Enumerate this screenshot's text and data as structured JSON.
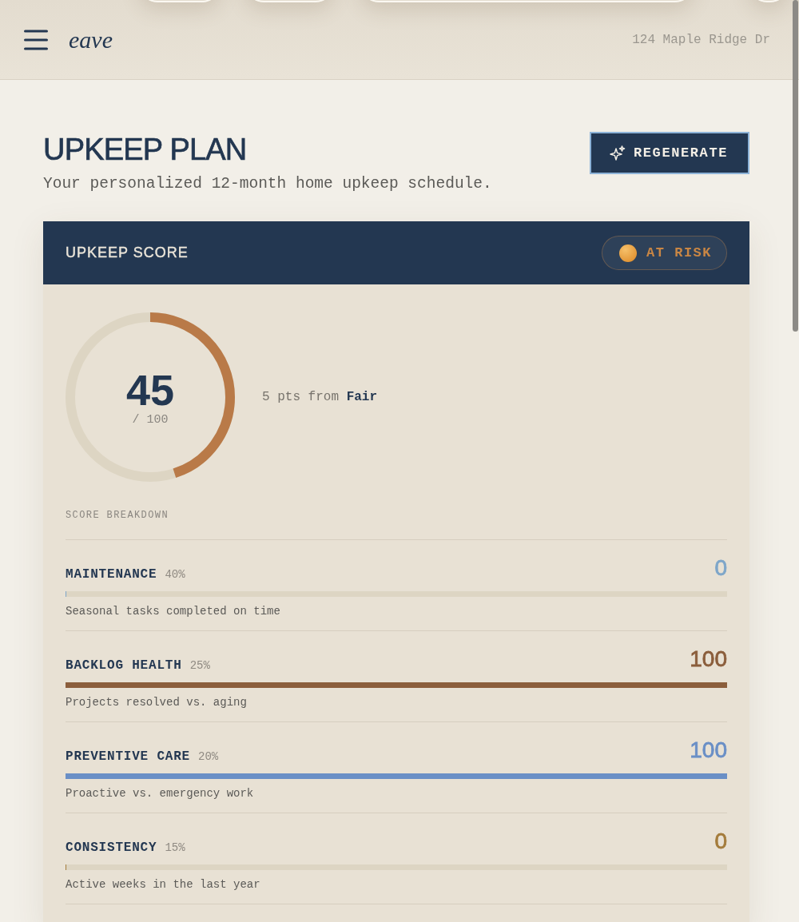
{
  "header": {
    "logo": "eave",
    "address": "124 Maple Ridge Dr"
  },
  "page": {
    "title": "UPKEEP PLAN",
    "subtitle": "Your personalized 12-month home upkeep schedule.",
    "action": "REGENERATE"
  },
  "score_card": {
    "title": "UPKEEP SCORE",
    "status": {
      "kind": "at_risk",
      "label": "AT RISK"
    },
    "score": {
      "value": "45",
      "max": "/ 100",
      "level": 0.45
    },
    "note": "5 pts from **Fair**",
    "breakdown_title": "SCORE BREAKDOWN",
    "breakdown": [
      {
        "name": "MAINTENANCE",
        "weight": "40%",
        "value": "0",
        "level": 0,
        "color": "#7ea6c9",
        "description": "Seasonal tasks completed on time"
      },
      {
        "name": "BACKLOG HEALTH",
        "weight": "25%",
        "value": "100",
        "level": 1,
        "color": "#8b5e3c",
        "description": "Projects resolved vs. aging"
      },
      {
        "name": "PREVENTIVE CARE",
        "weight": "20%",
        "value": "100",
        "level": 1,
        "color": "#6a8fc6",
        "description": "Proactive vs. emergency work"
      },
      {
        "name": "CONSISTENCY",
        "weight": "15%",
        "value": "0",
        "level": 0,
        "color": "#a47c3c",
        "description": "Active weeks in the last year"
      }
    ]
  }
}
